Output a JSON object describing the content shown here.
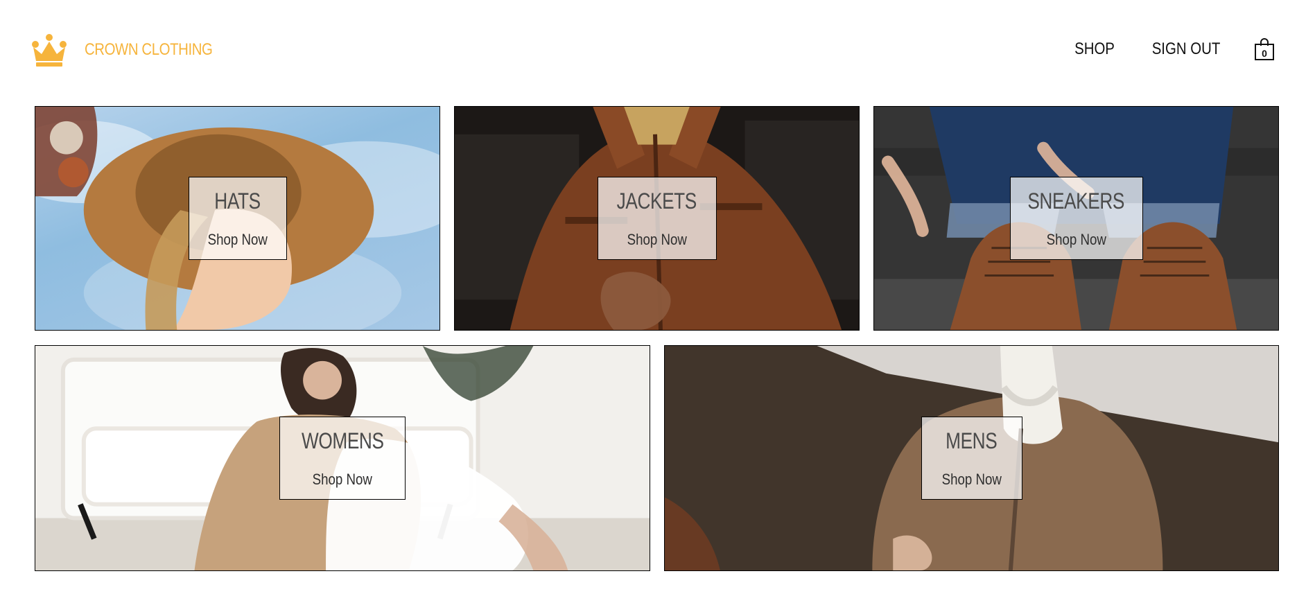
{
  "brand": {
    "name": "CROWN CLOTHING",
    "logo_icon": "crown-icon",
    "color": "#f6b43c"
  },
  "nav": {
    "links": [
      "SHOP",
      "SIGN OUT"
    ],
    "cart": {
      "icon": "shopping-bag-icon",
      "count": "0"
    }
  },
  "categories": [
    {
      "title": "HATS",
      "cta": "Shop Now"
    },
    {
      "title": "JACKETS",
      "cta": "Shop Now"
    },
    {
      "title": "SNEAKERS",
      "cta": "Shop Now"
    },
    {
      "title": "WOMENS",
      "cta": "Shop Now"
    },
    {
      "title": "MENS",
      "cta": "Shop Now"
    }
  ]
}
